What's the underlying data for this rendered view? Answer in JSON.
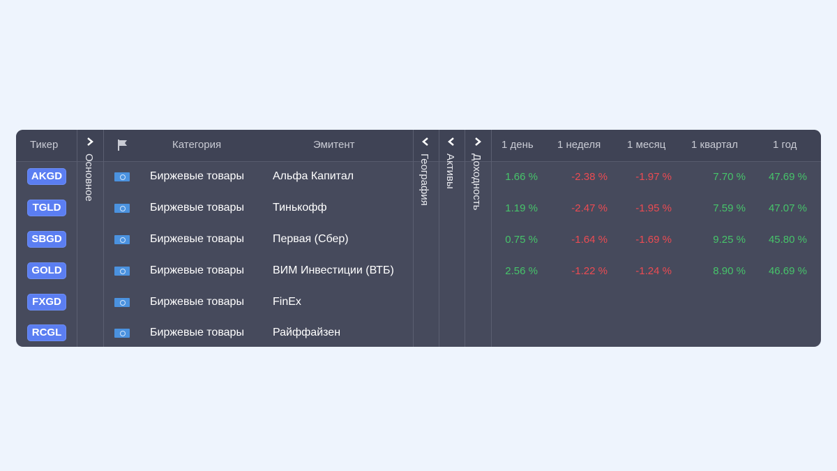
{
  "headers": {
    "ticker": "Тикер",
    "category": "Категория",
    "issuer": "Эмитент",
    "day": "1 день",
    "week": "1 неделя",
    "month": "1 месяц",
    "quarter": "1 квартал",
    "year": "1 год"
  },
  "groups": {
    "main": "Основное",
    "geography": "География",
    "assets": "Активы",
    "returns": "Доходность"
  },
  "icons": {
    "flag_header": "flag-icon",
    "country_flag": "un-flag-icon",
    "expand": "chevron-right-icon",
    "collapse": "chevron-left-icon"
  },
  "colors": {
    "ticker_badge": "#5b7ef2",
    "positive": "#46c46a",
    "negative": "#ec4b52",
    "panel": "#464a5c"
  },
  "rows": [
    {
      "ticker": "AKGD",
      "category": "Биржевые товары",
      "issuer": "Альфа Капитал",
      "day": "1.66 %",
      "week": "-2.38 %",
      "month": "-1.97 %",
      "quarter": "7.70 %",
      "year": "47.69 %"
    },
    {
      "ticker": "TGLD",
      "category": "Биржевые товары",
      "issuer": "Тинькофф",
      "day": "1.19 %",
      "week": "-2.47 %",
      "month": "-1.95 %",
      "quarter": "7.59 %",
      "year": "47.07 %"
    },
    {
      "ticker": "SBGD",
      "category": "Биржевые товары",
      "issuer": "Первая (Сбер)",
      "day": "0.75 %",
      "week": "-1.64 %",
      "month": "-1.69 %",
      "quarter": "9.25 %",
      "year": "45.80 %"
    },
    {
      "ticker": "GOLD",
      "category": "Биржевые товары",
      "issuer": "ВИМ Инвестиции (ВТБ)",
      "day": "2.56 %",
      "week": "-1.22 %",
      "month": "-1.24 %",
      "quarter": "8.90 %",
      "year": "46.69 %"
    },
    {
      "ticker": "FXGD",
      "category": "Биржевые товары",
      "issuer": "FinEx",
      "day": "",
      "week": "",
      "month": "",
      "quarter": "",
      "year": ""
    },
    {
      "ticker": "RCGL",
      "category": "Биржевые товары",
      "issuer": "Райффайзен",
      "day": "",
      "week": "",
      "month": "",
      "quarter": "",
      "year": ""
    }
  ]
}
